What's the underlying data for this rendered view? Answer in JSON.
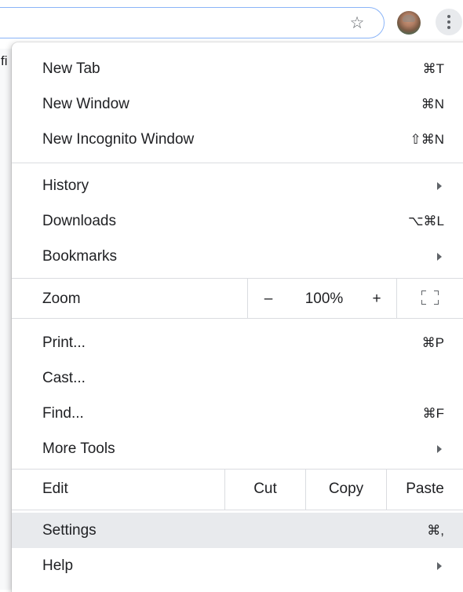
{
  "page": {
    "visible_glyph": "fi"
  },
  "toolbar": {
    "bookmark_icon": "star-icon",
    "profile_icon": "avatar",
    "menu_icon": "kebab-menu-icon"
  },
  "menu": {
    "items": {
      "new_tab": {
        "label": "New Tab",
        "shortcut": "⌘T"
      },
      "new_window": {
        "label": "New Window",
        "shortcut": "⌘N"
      },
      "new_incognito": {
        "label": "New Incognito Window",
        "shortcut": "⇧⌘N"
      },
      "history": {
        "label": "History",
        "submenu": true
      },
      "downloads": {
        "label": "Downloads",
        "shortcut": "⌥⌘L"
      },
      "bookmarks": {
        "label": "Bookmarks",
        "submenu": true
      },
      "print": {
        "label": "Print...",
        "shortcut": "⌘P"
      },
      "cast": {
        "label": "Cast..."
      },
      "find": {
        "label": "Find...",
        "shortcut": "⌘F"
      },
      "more_tools": {
        "label": "More Tools",
        "submenu": true
      },
      "settings": {
        "label": "Settings",
        "shortcut": "⌘,",
        "highlighted": true
      },
      "help": {
        "label": "Help",
        "submenu": true
      }
    },
    "zoom": {
      "label": "Zoom",
      "minus": "–",
      "value": "100%",
      "plus": "+",
      "fullscreen_icon": "fullscreen-icon"
    },
    "edit": {
      "label": "Edit",
      "cut": "Cut",
      "copy": "Copy",
      "paste": "Paste"
    }
  },
  "colors": {
    "highlight": "#e8eaed",
    "separator": "#dadce0",
    "omnibox_border": "#8ab4f8"
  }
}
